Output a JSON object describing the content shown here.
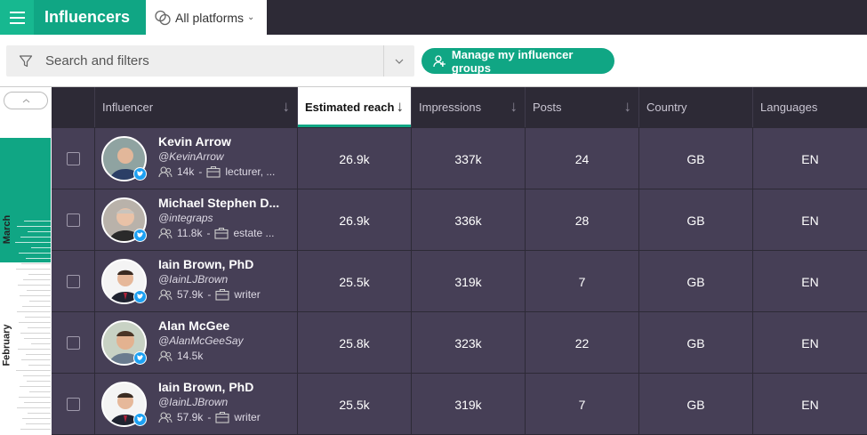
{
  "app": {
    "brand": "Influencers",
    "platform_selector": "All platforms"
  },
  "search": {
    "placeholder": "Search and filters"
  },
  "actions": {
    "manage_groups": "Manage my influencer groups"
  },
  "timeline": {
    "months": [
      "March",
      "February"
    ]
  },
  "table": {
    "columns": [
      "Influencer",
      "Estimated reach",
      "Impressions",
      "Posts",
      "Country",
      "Languages"
    ],
    "sorted_column": "Estimated reach",
    "rows": [
      {
        "name": "Kevin Arrow",
        "handle": "@KevinArrow",
        "followers": "14k",
        "occupation": "lecturer, ...",
        "reach": "26.9k",
        "impressions": "337k",
        "posts": "24",
        "country": "GB",
        "language": "EN"
      },
      {
        "name": "Michael Stephen D...",
        "handle": "@integraps",
        "followers": "11.8k",
        "occupation": "estate ...",
        "reach": "26.9k",
        "impressions": "336k",
        "posts": "28",
        "country": "GB",
        "language": "EN"
      },
      {
        "name": "Iain Brown, PhD",
        "handle": "@IainLJBrown",
        "followers": "57.9k",
        "occupation": "writer",
        "reach": "25.5k",
        "impressions": "319k",
        "posts": "7",
        "country": "GB",
        "language": "EN"
      },
      {
        "name": "Alan McGee",
        "handle": "@AlanMcGeeSay",
        "followers": "14.5k",
        "occupation": "",
        "reach": "25.8k",
        "impressions": "323k",
        "posts": "22",
        "country": "GB",
        "language": "EN"
      },
      {
        "name": "Iain Brown, PhD",
        "handle": "@IainLJBrown",
        "followers": "57.9k",
        "occupation": "writer",
        "reach": "25.5k",
        "impressions": "319k",
        "posts": "7",
        "country": "GB",
        "language": "EN"
      }
    ]
  },
  "colors": {
    "accent": "#10a684",
    "header_bg": "#2d2a36",
    "row_bg": "#463f56",
    "twitter": "#1da1f2"
  }
}
